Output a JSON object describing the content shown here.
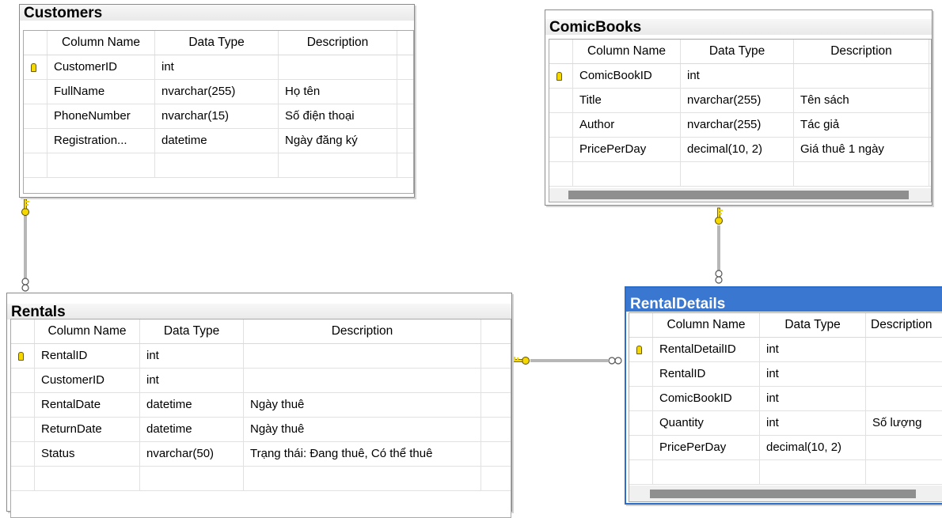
{
  "headers": {
    "column_name": "Column Name",
    "data_type": "Data Type",
    "description": "Description"
  },
  "tables": {
    "customers": {
      "title": "Customers",
      "rows": [
        {
          "name": "CustomerID",
          "type": "int",
          "desc": "",
          "pk": true
        },
        {
          "name": "FullName",
          "type": "nvarchar(255)",
          "desc": "Họ tên"
        },
        {
          "name": "PhoneNumber",
          "type": "nvarchar(15)",
          "desc": "Số điện thoại"
        },
        {
          "name": "Registration...",
          "type": "datetime",
          "desc": "Ngày đăng ký"
        }
      ]
    },
    "comicbooks": {
      "title": "ComicBooks",
      "rows": [
        {
          "name": "ComicBookID",
          "type": "int",
          "desc": "",
          "pk": true
        },
        {
          "name": "Title",
          "type": "nvarchar(255)",
          "desc": "Tên sách"
        },
        {
          "name": "Author",
          "type": "nvarchar(255)",
          "desc": "Tác giả"
        },
        {
          "name": "PricePerDay",
          "type": "decimal(10, 2)",
          "desc": "Giá thuê 1 ngày"
        }
      ]
    },
    "rentals": {
      "title": "Rentals",
      "rows": [
        {
          "name": "RentalID",
          "type": "int",
          "desc": "",
          "pk": true
        },
        {
          "name": "CustomerID",
          "type": "int",
          "desc": ""
        },
        {
          "name": "RentalDate",
          "type": "datetime",
          "desc": "Ngày thuê"
        },
        {
          "name": "ReturnDate",
          "type": "datetime",
          "desc": "Ngày thuê"
        },
        {
          "name": "Status",
          "type": "nvarchar(50)",
          "desc": "Trạng thái: Đang thuê, Có thể thuê"
        }
      ]
    },
    "rentaldetails": {
      "title": "RentalDetails",
      "rows": [
        {
          "name": "RentalDetailID",
          "type": "int",
          "desc": "",
          "pk": true
        },
        {
          "name": "RentalID",
          "type": "int",
          "desc": ""
        },
        {
          "name": "ComicBookID",
          "type": "int",
          "desc": ""
        },
        {
          "name": "Quantity",
          "type": "int",
          "desc": "Số lượng"
        },
        {
          "name": "PricePerDay",
          "type": "decimal(10, 2)",
          "desc": ""
        }
      ]
    }
  },
  "colors": {
    "selected_title": "#3a77d0",
    "key": "#f5d800",
    "connector": "#6f6f6f"
  }
}
